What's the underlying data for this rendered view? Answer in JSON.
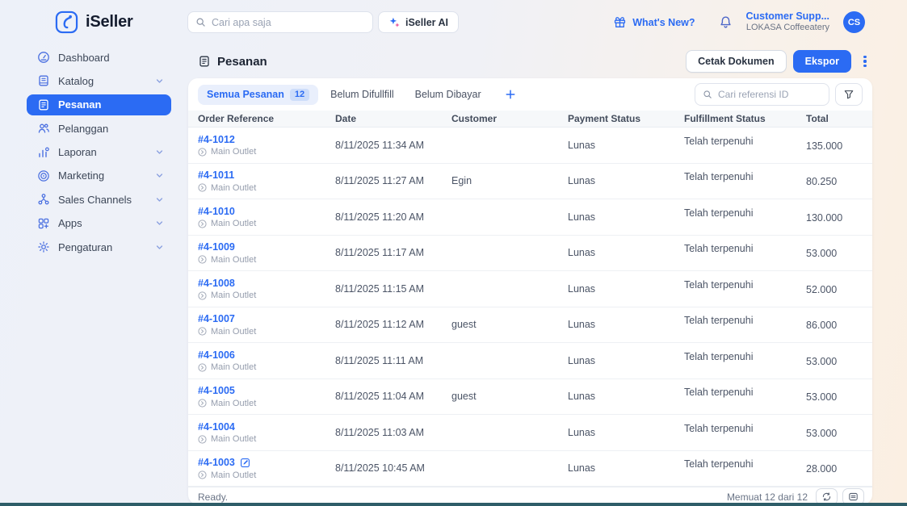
{
  "brand": {
    "name": "iSeller"
  },
  "header": {
    "search_placeholder": "Cari apa saja",
    "ai_button": "iSeller AI",
    "whats_new": "What's New?",
    "account_name": "Customer Supp...",
    "account_org": "LOKASA Coffeeatery",
    "avatar_initials": "CS"
  },
  "sidebar": {
    "items": [
      {
        "label": "Dashboard",
        "icon": "dashboard-icon",
        "active": false,
        "expandable": false
      },
      {
        "label": "Katalog",
        "icon": "katalog-icon",
        "active": false,
        "expandable": true
      },
      {
        "label": "Pesanan",
        "icon": "pesanan-icon",
        "active": true,
        "expandable": false
      },
      {
        "label": "Pelanggan",
        "icon": "pelanggan-icon",
        "active": false,
        "expandable": false
      },
      {
        "label": "Laporan",
        "icon": "laporan-icon",
        "active": false,
        "expandable": true
      },
      {
        "label": "Marketing",
        "icon": "marketing-icon",
        "active": false,
        "expandable": true
      },
      {
        "label": "Sales Channels",
        "icon": "sales-channels-icon",
        "active": false,
        "expandable": true
      },
      {
        "label": "Apps",
        "icon": "apps-icon",
        "active": false,
        "expandable": true
      },
      {
        "label": "Pengaturan",
        "icon": "pengaturan-icon",
        "active": false,
        "expandable": true
      }
    ]
  },
  "page": {
    "title": "Pesanan",
    "print_button": "Cetak Dokumen",
    "export_button": "Ekspor"
  },
  "tabs": [
    {
      "label": "Semua Pesanan",
      "badge": "12",
      "active": true
    },
    {
      "label": "Belum Difullfill",
      "active": false
    },
    {
      "label": "Belum Dibayar",
      "active": false
    }
  ],
  "table_search": {
    "placeholder": "Cari referensi ID"
  },
  "table": {
    "columns": [
      "Order Reference",
      "Date",
      "Customer",
      "Payment Status",
      "Fulfillment Status",
      "Total"
    ],
    "rows": [
      {
        "ref": "#4-1012",
        "outlet": "Main Outlet",
        "date": "8/11/2025 11:34 AM",
        "customer": "",
        "payment": "Lunas",
        "fulfillment": "Telah terpenuhi",
        "total": "135.000",
        "editable": false
      },
      {
        "ref": "#4-1011",
        "outlet": "Main Outlet",
        "date": "8/11/2025 11:27 AM",
        "customer": "Egin",
        "payment": "Lunas",
        "fulfillment": "Telah terpenuhi",
        "total": "80.250",
        "editable": false
      },
      {
        "ref": "#4-1010",
        "outlet": "Main Outlet",
        "date": "8/11/2025 11:20 AM",
        "customer": "",
        "payment": "Lunas",
        "fulfillment": "Telah terpenuhi",
        "total": "130.000",
        "editable": false
      },
      {
        "ref": "#4-1009",
        "outlet": "Main Outlet",
        "date": "8/11/2025 11:17 AM",
        "customer": "",
        "payment": "Lunas",
        "fulfillment": "Telah terpenuhi",
        "total": "53.000",
        "editable": false
      },
      {
        "ref": "#4-1008",
        "outlet": "Main Outlet",
        "date": "8/11/2025 11:15 AM",
        "customer": "",
        "payment": "Lunas",
        "fulfillment": "Telah terpenuhi",
        "total": "52.000",
        "editable": false
      },
      {
        "ref": "#4-1007",
        "outlet": "Main Outlet",
        "date": "8/11/2025 11:12 AM",
        "customer": "guest",
        "payment": "Lunas",
        "fulfillment": "Telah terpenuhi",
        "total": "86.000",
        "editable": false
      },
      {
        "ref": "#4-1006",
        "outlet": "Main Outlet",
        "date": "8/11/2025 11:11 AM",
        "customer": "",
        "payment": "Lunas",
        "fulfillment": "Telah terpenuhi",
        "total": "53.000",
        "editable": false
      },
      {
        "ref": "#4-1005",
        "outlet": "Main Outlet",
        "date": "8/11/2025 11:04 AM",
        "customer": "guest",
        "payment": "Lunas",
        "fulfillment": "Telah terpenuhi",
        "total": "53.000",
        "editable": false
      },
      {
        "ref": "#4-1004",
        "outlet": "Main Outlet",
        "date": "8/11/2025 11:03 AM",
        "customer": "",
        "payment": "Lunas",
        "fulfillment": "Telah terpenuhi",
        "total": "53.000",
        "editable": false
      },
      {
        "ref": "#4-1003",
        "outlet": "Main Outlet",
        "date": "8/11/2025 10:45 AM",
        "customer": "",
        "payment": "Lunas",
        "fulfillment": "Telah terpenuhi",
        "total": "28.000",
        "editable": true
      }
    ]
  },
  "footer": {
    "status": "Ready.",
    "count": "Memuat 12 dari 12"
  },
  "colors": {
    "primary": "#2b6bf3",
    "link": "#2b6bf3",
    "active_tab_bg": "#e9effc",
    "badge_bg": "#cdddfa",
    "table_header_bg": "#f6f8fa",
    "page_bg_left": "#edf1f9",
    "page_bg_right": "#fbefe2",
    "bottom_bar": "#2e5d68",
    "alert_dot": "#f4323c"
  },
  "icons": {
    "iseller-logo-icon": "rounded-square-with-j-glyph",
    "search-icon": "magnifier",
    "sparkle-icon": "ai-sparkles",
    "gift-icon": "gift-box",
    "bell-icon": "notification-bell",
    "kebab-menu-icon": "vertical-dots",
    "plus-icon": "plus",
    "funnel-icon": "filter-funnel",
    "outlet-icon": "circled-arrow",
    "edit-icon": "pencil-square",
    "refresh-icon": "circular-arrows",
    "list-icon": "panel-with-lines",
    "chevron-down-icon": "chevron-down"
  }
}
